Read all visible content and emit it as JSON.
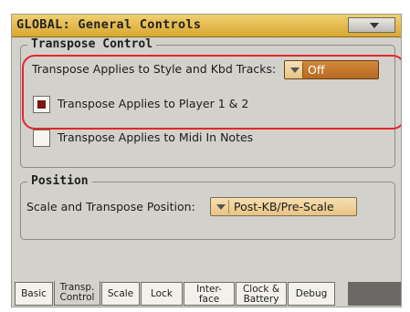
{
  "window": {
    "title": "GLOBAL: General Controls"
  },
  "transpose_control": {
    "label": "Transpose Control",
    "style_kbd_label": "Transpose Applies to Style and Kbd Tracks:",
    "style_kbd_value": "Off",
    "player_label": "Transpose Applies to Player 1 & 2",
    "player_checked": true,
    "midi_label": "Transpose Applies to Midi In Notes",
    "midi_checked": false
  },
  "position": {
    "label": "Position",
    "scale_transpose_label": "Scale and Transpose Position:",
    "scale_transpose_value": "Post-KB/Pre-Scale"
  },
  "tabs": [
    {
      "line1": "Basic",
      "line2": ""
    },
    {
      "line1": "Transp.",
      "line2": "Control",
      "active": true
    },
    {
      "line1": "Scale",
      "line2": ""
    },
    {
      "line1": "Lock",
      "line2": ""
    },
    {
      "line1": "Inter-",
      "line2": "face"
    },
    {
      "line1": "Clock &",
      "line2": "Battery"
    },
    {
      "line1": "Debug",
      "line2": ""
    }
  ],
  "colors": {
    "titlebar": "#e0b545",
    "dropdown_active": "#c47a2e",
    "highlight": "#e5252e",
    "checkbox_mark": "#7a1616"
  }
}
